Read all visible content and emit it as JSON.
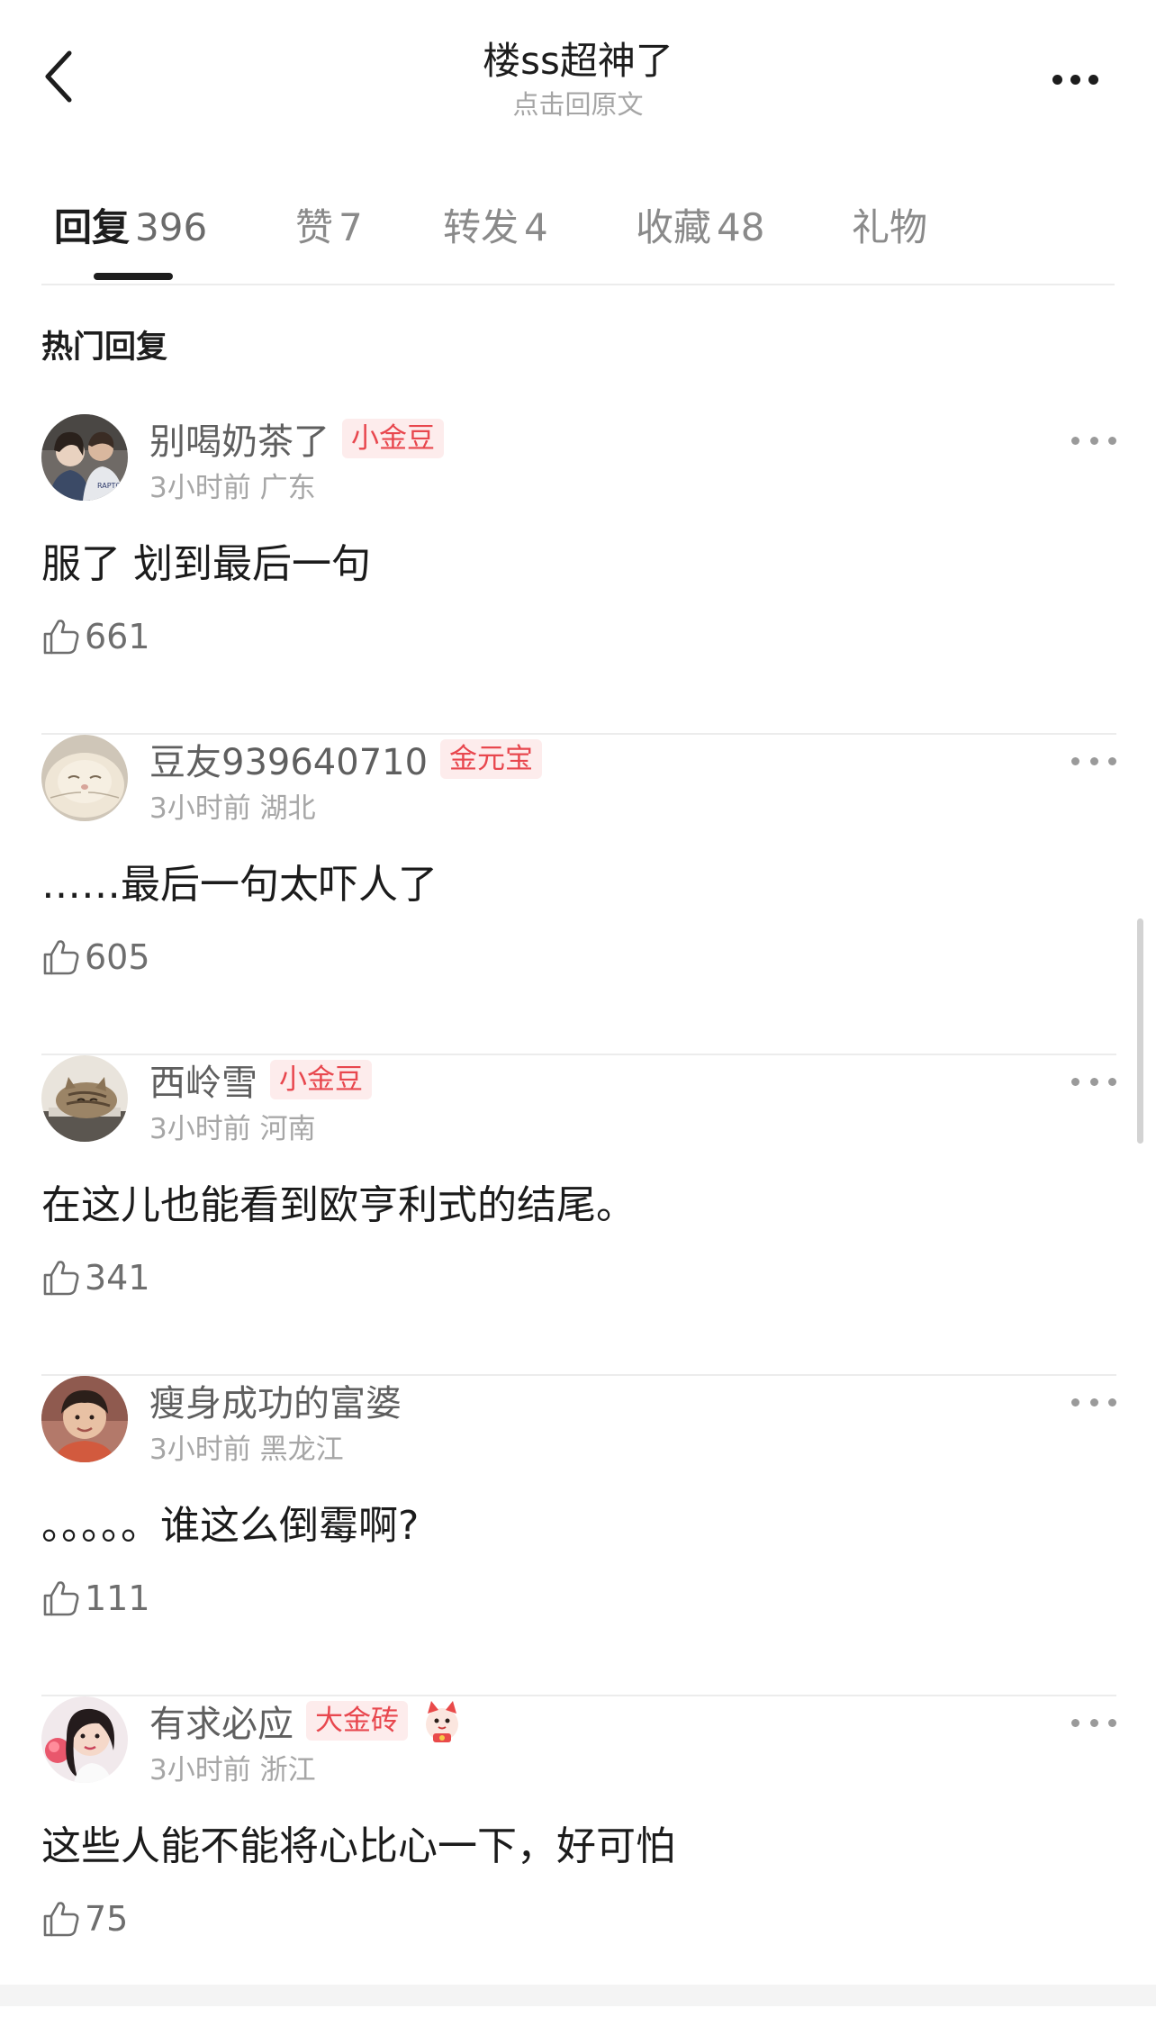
{
  "header": {
    "back_icon": "chevron-left-icon",
    "title": "楼ss超神了",
    "subtitle": "点击回原文",
    "more_icon": "more-horizontal-icon"
  },
  "tabs": [
    {
      "label": "回复",
      "count": "396",
      "active": true
    },
    {
      "label": "赞",
      "count": "7",
      "active": false
    },
    {
      "label": "转发",
      "count": "4",
      "active": false
    },
    {
      "label": "收藏",
      "count": "48",
      "active": false
    },
    {
      "label": "礼物",
      "count": "",
      "active": false
    }
  ],
  "section_title": "热门回复",
  "comments": [
    {
      "username": "别喝奶茶了",
      "badge": "小金豆",
      "time": "3小时前",
      "location": "广东",
      "text": "服了 划到最后一句",
      "likes": "661",
      "avatar_icon": "avatar-couple-photo"
    },
    {
      "username": "豆友939640710",
      "badge": "金元宝",
      "time": "3小时前",
      "location": "湖北",
      "text": "……最后一句太吓人了",
      "likes": "605",
      "avatar_icon": "avatar-sleeping-cat"
    },
    {
      "username": "西岭雪",
      "badge": "小金豆",
      "time": "3小时前",
      "location": "河南",
      "text": "在这儿也能看到欧亨利式的结尾。",
      "likes": "341",
      "avatar_icon": "avatar-tabby-cat"
    },
    {
      "username": "瘦身成功的富婆",
      "badge": "",
      "time": "3小时前",
      "location": "黑龙江",
      "text": "。。。。。谁这么倒霉啊?",
      "likes": "111",
      "avatar_icon": "avatar-child-portrait"
    },
    {
      "username": "有求必应",
      "badge": "大金砖",
      "time": "3小时前",
      "location": "浙江",
      "text": "这些人能不能将心比心一下，好可怕",
      "likes": "75",
      "avatar_icon": "avatar-woman-portrait",
      "sticker_icon": "lucky-cat-sticker-icon"
    }
  ],
  "colors": {
    "badge_text": "#e8474e",
    "badge_bg": "#fdecec",
    "primary_text": "#1b1b1b",
    "secondary_text": "#a6a6a6"
  }
}
